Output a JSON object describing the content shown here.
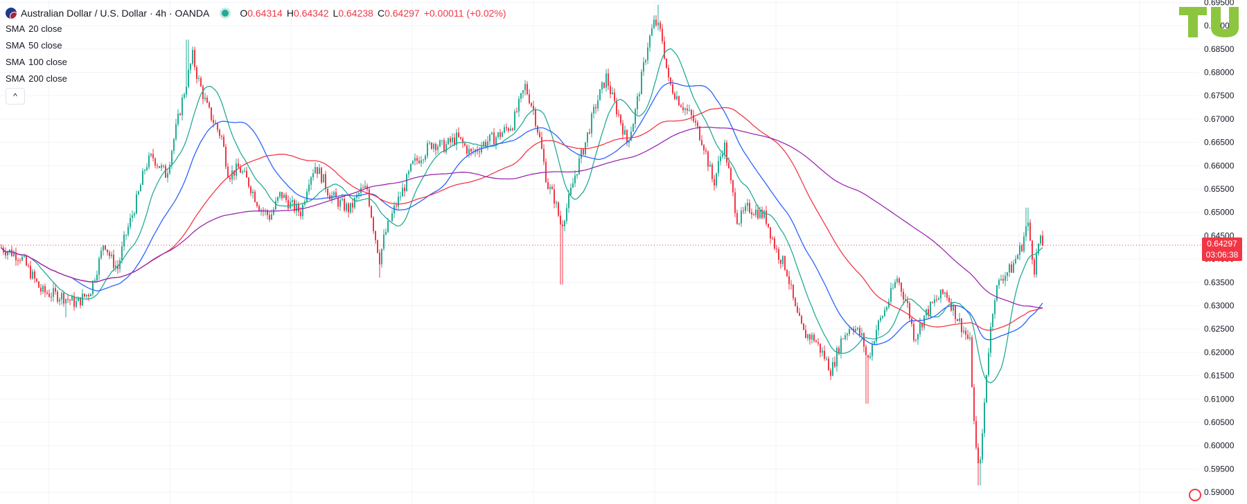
{
  "header": {
    "symbol_title": "Australian Dollar / U.S. Dollar · 4h · OANDA",
    "ohlc": [
      {
        "key": "O",
        "value": "0.64314"
      },
      {
        "key": "H",
        "value": "0.64342"
      },
      {
        "key": "L",
        "value": "0.64238"
      },
      {
        "key": "C",
        "value": "0.64297"
      }
    ],
    "change": "+0.00011 (+0.02%)"
  },
  "indicators": [
    {
      "name": "SMA",
      "params": "20 close",
      "color": "#22ab94"
    },
    {
      "name": "SMA",
      "params": "50 close",
      "color": "#2962ff"
    },
    {
      "name": "SMA",
      "params": "100 close",
      "color": "#f23645"
    },
    {
      "name": "SMA",
      "params": "200 close",
      "color": "#9c27b0"
    }
  ],
  "collapse_glyph": "^",
  "logo_text": "TU",
  "last_price": {
    "value": "0.64297",
    "countdown": "03:06:38"
  },
  "colors": {
    "up": "#22ab94",
    "down": "#f23645",
    "grid": "#f0f3fa",
    "axis_text": "#131722"
  },
  "chart_data": {
    "type": "candlestick",
    "ylim": [
      0.5875,
      0.6955
    ],
    "y_ticks": [
      "0.59000",
      "0.59500",
      "0.60000",
      "0.60500",
      "0.61000",
      "0.61500",
      "0.62000",
      "0.62500",
      "0.63000",
      "0.63500",
      "0.64000",
      "0.64500",
      "0.65000",
      "0.65500",
      "0.66000",
      "0.66500",
      "0.67000",
      "0.67500",
      "0.68000",
      "0.68500",
      "0.69000",
      "0.69500"
    ],
    "close_path": [
      [
        0,
        0.6425
      ],
      [
        30,
        0.6405
      ],
      [
        60,
        0.633
      ],
      [
        90,
        0.632
      ],
      [
        110,
        0.6305
      ],
      [
        130,
        0.633
      ],
      [
        145,
        0.6405
      ],
      [
        150,
        0.644
      ],
      [
        160,
        0.64
      ],
      [
        170,
        0.638
      ],
      [
        180,
        0.6445
      ],
      [
        190,
        0.649
      ],
      [
        200,
        0.654
      ],
      [
        210,
        0.66
      ],
      [
        220,
        0.662
      ],
      [
        230,
        0.66
      ],
      [
        240,
        0.658
      ],
      [
        250,
        0.665
      ],
      [
        260,
        0.672
      ],
      [
        270,
        0.6785
      ],
      [
        278,
        0.6835
      ],
      [
        285,
        0.679
      ],
      [
        300,
        0.672
      ],
      [
        320,
        0.666
      ],
      [
        330,
        0.658
      ],
      [
        345,
        0.6595
      ],
      [
        360,
        0.656
      ],
      [
        375,
        0.651
      ],
      [
        390,
        0.649
      ],
      [
        405,
        0.654
      ],
      [
        420,
        0.6515
      ],
      [
        435,
        0.65
      ],
      [
        445,
        0.657
      ],
      [
        455,
        0.66
      ],
      [
        465,
        0.6575
      ],
      [
        475,
        0.654
      ],
      [
        490,
        0.652
      ],
      [
        505,
        0.6505
      ],
      [
        520,
        0.6545
      ],
      [
        530,
        0.655
      ],
      [
        540,
        0.646
      ],
      [
        548,
        0.64
      ],
      [
        555,
        0.645
      ],
      [
        570,
        0.651
      ],
      [
        585,
        0.656
      ],
      [
        595,
        0.66
      ],
      [
        610,
        0.6625
      ],
      [
        625,
        0.665
      ],
      [
        640,
        0.664
      ],
      [
        660,
        0.666
      ],
      [
        680,
        0.6625
      ],
      [
        700,
        0.665
      ],
      [
        720,
        0.6665
      ],
      [
        740,
        0.669
      ],
      [
        758,
        0.677
      ],
      [
        770,
        0.672
      ],
      [
        780,
        0.665
      ],
      [
        790,
        0.656
      ],
      [
        800,
        0.653
      ],
      [
        810,
        0.647
      ],
      [
        820,
        0.652
      ],
      [
        830,
        0.658
      ],
      [
        845,
        0.665
      ],
      [
        860,
        0.673
      ],
      [
        875,
        0.679
      ],
      [
        885,
        0.674
      ],
      [
        895,
        0.67
      ],
      [
        905,
        0.665
      ],
      [
        915,
        0.67
      ],
      [
        925,
        0.678
      ],
      [
        935,
        0.686
      ],
      [
        945,
        0.691
      ],
      [
        955,
        0.688
      ],
      [
        965,
        0.678
      ],
      [
        980,
        0.674
      ],
      [
        1000,
        0.67
      ],
      [
        1015,
        0.665
      ],
      [
        1030,
        0.656
      ],
      [
        1045,
        0.665
      ],
      [
        1055,
        0.656
      ],
      [
        1065,
        0.648
      ],
      [
        1080,
        0.651
      ],
      [
        1095,
        0.65
      ],
      [
        1105,
        0.649
      ],
      [
        1120,
        0.642
      ],
      [
        1135,
        0.638
      ],
      [
        1148,
        0.629
      ],
      [
        1160,
        0.624
      ],
      [
        1175,
        0.623
      ],
      [
        1190,
        0.619
      ],
      [
        1200,
        0.616
      ],
      [
        1215,
        0.623
      ],
      [
        1230,
        0.626
      ],
      [
        1245,
        0.623
      ],
      [
        1252,
        0.618
      ],
      [
        1265,
        0.625
      ],
      [
        1280,
        0.63
      ],
      [
        1295,
        0.636
      ],
      [
        1310,
        0.63
      ],
      [
        1320,
        0.623
      ],
      [
        1335,
        0.628
      ],
      [
        1350,
        0.631
      ],
      [
        1365,
        0.633
      ],
      [
        1380,
        0.628
      ],
      [
        1390,
        0.625
      ],
      [
        1400,
        0.622
      ],
      [
        1408,
        0.599
      ],
      [
        1415,
        0.596
      ],
      [
        1425,
        0.618
      ],
      [
        1435,
        0.632
      ],
      [
        1445,
        0.636
      ],
      [
        1460,
        0.638
      ],
      [
        1475,
        0.643
      ],
      [
        1483,
        0.648
      ],
      [
        1493,
        0.638
      ],
      [
        1500,
        0.644
      ],
      [
        1505,
        0.643
      ]
    ],
    "wick_extremes": [
      [
        95,
        0.6275
      ],
      [
        270,
        0.687
      ],
      [
        548,
        0.636
      ],
      [
        811,
        0.6345
      ],
      [
        950,
        0.6945
      ],
      [
        1252,
        0.609
      ],
      [
        1413,
        0.5915
      ],
      [
        1482,
        0.651
      ]
    ],
    "series": [
      {
        "name": "SMA 20 close",
        "period": 15,
        "color": "#22ab94"
      },
      {
        "name": "SMA 50 close",
        "period": 35,
        "color": "#2962ff"
      },
      {
        "name": "SMA 100 close",
        "period": 70,
        "color": "#f23645"
      },
      {
        "name": "SMA 200 close",
        "period": 140,
        "color": "#9c27b0"
      }
    ],
    "last_close": 0.64297
  }
}
